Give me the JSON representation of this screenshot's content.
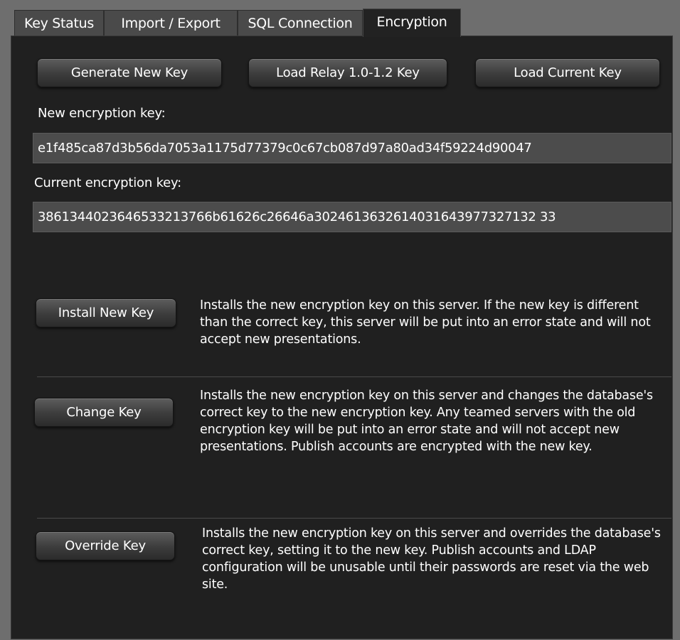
{
  "tabs": [
    {
      "label": "Key Status",
      "active": false
    },
    {
      "label": "Import / Export",
      "active": false
    },
    {
      "label": "SQL Connection",
      "active": false
    },
    {
      "label": "Encryption",
      "active": true
    }
  ],
  "top_buttons": {
    "generate": "Generate New Key",
    "load_relay": "Load Relay 1.0-1.2 Key",
    "load_current": "Load Current Key"
  },
  "new_key": {
    "label": "New encryption key:",
    "value": "e1f485ca87d3b56da7053a1175d77379c0c67cb087d97a80ad34f59224d90047"
  },
  "current_key": {
    "label": "Current encryption key:",
    "value": "3861344023646533213766b61626c26646a3024613632614031643977327132 33"
  },
  "actions": [
    {
      "button": "Install New Key",
      "description": "Installs the new encryption key on this server. If the new key is different than the correct key, this server will be put into an error state and will not accept new presentations."
    },
    {
      "button": "Change Key",
      "description": "Installs the new encryption key on this server and changes the database's correct key to the new encryption key. Any teamed servers with the old encryption key will be put into an error state and will not accept new presentations.  Publish accounts are encrypted with the new key."
    },
    {
      "button": "Override Key",
      "description": "Installs the new encryption key on this server and overrides the database's correct key, setting it to the new key. Publish accounts and LDAP configuration will be unusable until their passwords are reset via the web site."
    }
  ],
  "colors": {
    "panel_bg": "#202020",
    "outer_bg": "#6e6e6e",
    "field_bg": "#4c4c4c",
    "text": "#ffffff"
  }
}
